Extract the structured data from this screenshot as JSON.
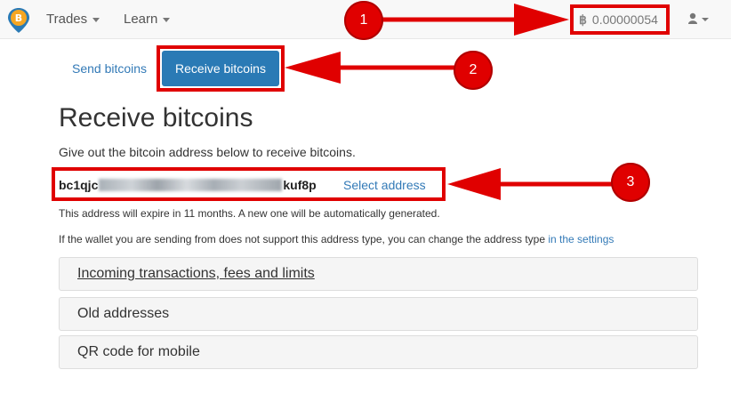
{
  "nav": {
    "items": [
      {
        "label": "Trades"
      },
      {
        "label": "Learn"
      }
    ],
    "balance_symbol": "฿",
    "balance": "0.00000054"
  },
  "tabs": {
    "send": "Send bitcoins",
    "receive": "Receive bitcoins"
  },
  "page": {
    "title": "Receive bitcoins",
    "description": "Give out the bitcoin address below to receive bitcoins.",
    "address_prefix": "bc1qjc",
    "address_suffix": "kuf8p",
    "select_address": "Select address",
    "expire_note": "This address will expire in 11 months. A new one will be automatically generated.",
    "wallet_note": "If the wallet you are sending from does not support this address type, you can change the address type ",
    "wallet_link": "in the settings"
  },
  "panels": [
    {
      "label": "Incoming transactions, fees and limits"
    },
    {
      "label": "Old addresses"
    },
    {
      "label": "QR code for mobile"
    }
  ],
  "annotations": [
    "1",
    "2",
    "3"
  ],
  "colors": {
    "accent": "#2a7ab5",
    "link": "#337ab7",
    "annotation_red": "#e00000"
  }
}
